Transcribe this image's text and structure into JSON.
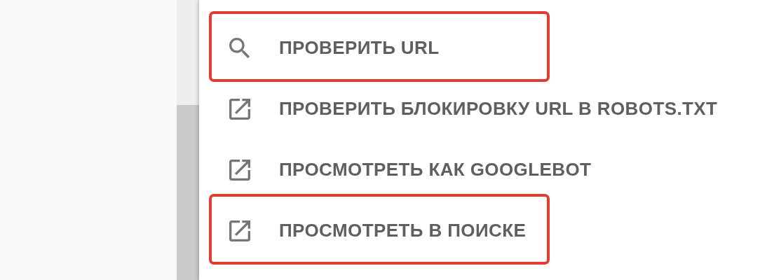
{
  "menu": {
    "items": [
      {
        "kind": "search",
        "label": "ПРОВЕРИТЬ URL",
        "highlighted": true
      },
      {
        "kind": "external",
        "label": "ПРОВЕРИТЬ БЛОКИРОВКУ URL В ROBOTS.TXT",
        "highlighted": false
      },
      {
        "kind": "external",
        "label": "ПРОСМОТРЕТЬ КАК GOOGLEBOT",
        "highlighted": false
      },
      {
        "kind": "external",
        "label": "ПРОСМОТРЕТЬ В ПОИСКЕ",
        "highlighted": true
      }
    ]
  }
}
